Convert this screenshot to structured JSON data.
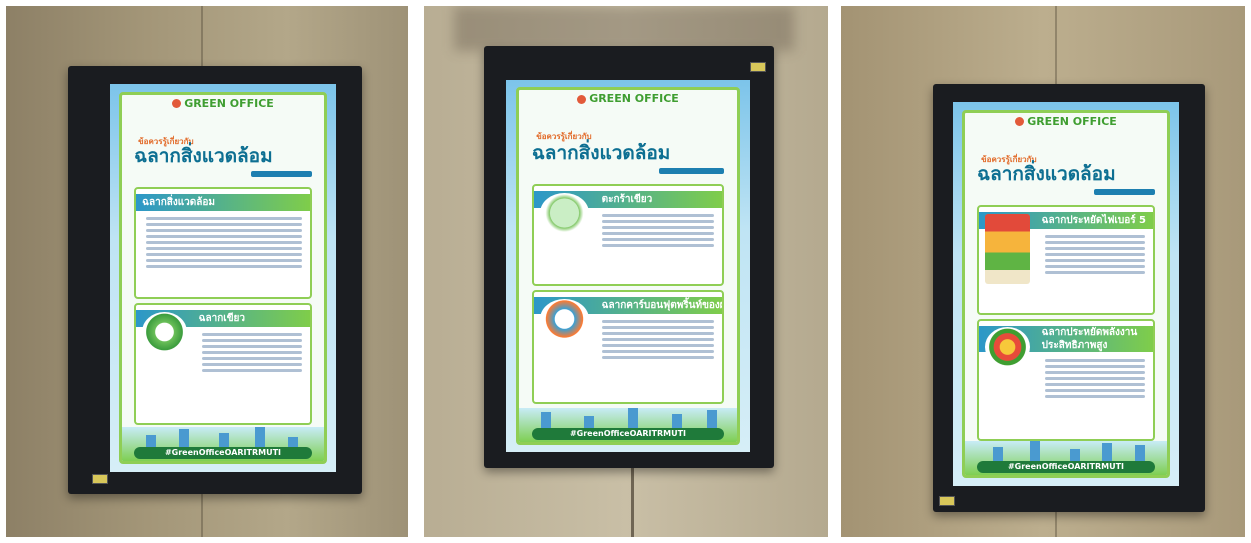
{
  "photos": [
    {
      "logo": "GREEN OFFICE",
      "eyebrow": "ข้อควรรู้เกี่ยวกับ",
      "title": "ฉลากสิ่งแวดล้อม",
      "cards": [
        "ฉลากสิ่งแวดล้อม",
        "ฉลากเขียว"
      ],
      "hashtag": "#GreenOfficeOARITRMUTI"
    },
    {
      "logo": "GREEN OFFICE",
      "eyebrow": "ข้อควรรู้เกี่ยวกับ",
      "title": "ฉลากสิ่งแวดล้อม",
      "cards": [
        "ตะกร้าเขียว",
        "ฉลากคาร์บอนฟุตพริ้นท์ของผลิตภัณฑ์"
      ],
      "hashtag": "#GreenOfficeOARITRMUTI"
    },
    {
      "logo": "GREEN OFFICE",
      "eyebrow": "ข้อควรรู้เกี่ยวกับ",
      "title": "ฉลากสิ่งแวดล้อม",
      "cards": [
        "ฉลากประหยัดไฟเบอร์ 5",
        "ฉลากประหยัดพลังงาน ประสิทธิภาพสูง"
      ],
      "hashtag": "#GreenOfficeOARITRMUTI"
    }
  ]
}
